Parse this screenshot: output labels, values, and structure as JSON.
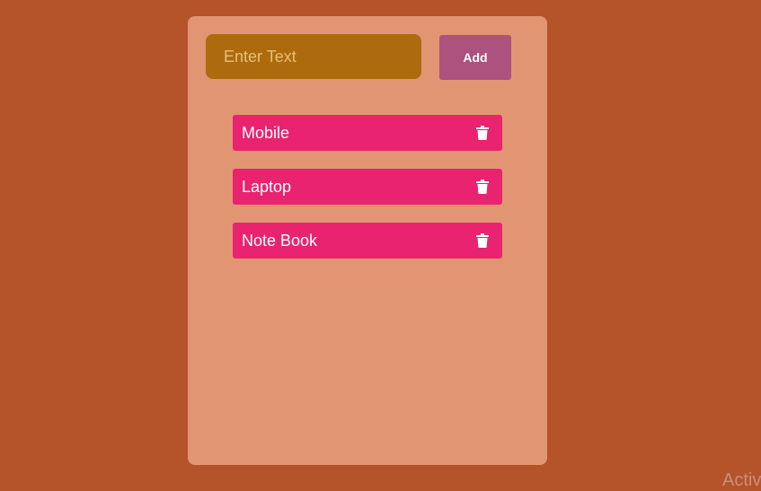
{
  "app": {
    "input": {
      "placeholder": "Enter Text",
      "value": ""
    },
    "add_label": "Add",
    "items": [
      {
        "label": "Mobile",
        "icon": "trash-icon"
      },
      {
        "label": "Laptop",
        "icon": "trash-icon"
      },
      {
        "label": "Note Book",
        "icon": "trash-icon"
      }
    ]
  },
  "watermark": "Activ",
  "colors": {
    "background": "#b5532a",
    "card": "#e29572",
    "input": "#ae6b0d",
    "add_button": "#ad517f",
    "item": "#e9236f"
  }
}
